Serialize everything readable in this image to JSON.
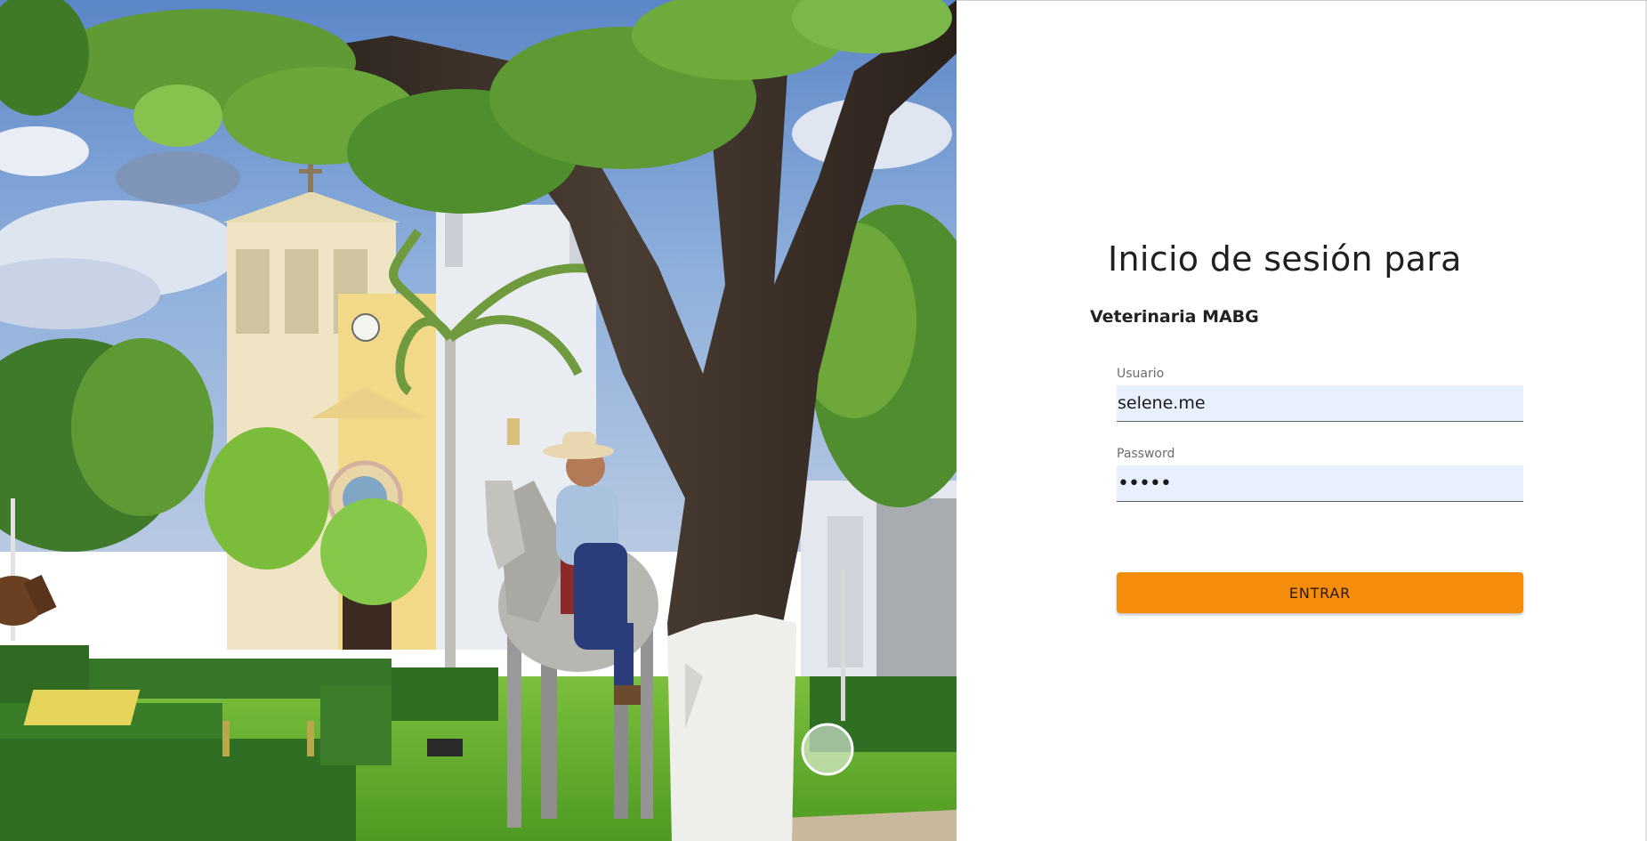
{
  "login": {
    "title": "Inicio de sesión para",
    "subtitle": "Veterinaria MABG",
    "username": {
      "label": "Usuario",
      "value": "selene.me"
    },
    "password": {
      "label": "Password",
      "value": "•••••"
    },
    "submit_label": "ENTRAR"
  },
  "colors": {
    "button": "#f68c0b",
    "input_fill": "#e8f0fe",
    "panel": "#ffffff"
  },
  "photo": {
    "subject": "rider-on-horse-in-plaza-with-church"
  }
}
